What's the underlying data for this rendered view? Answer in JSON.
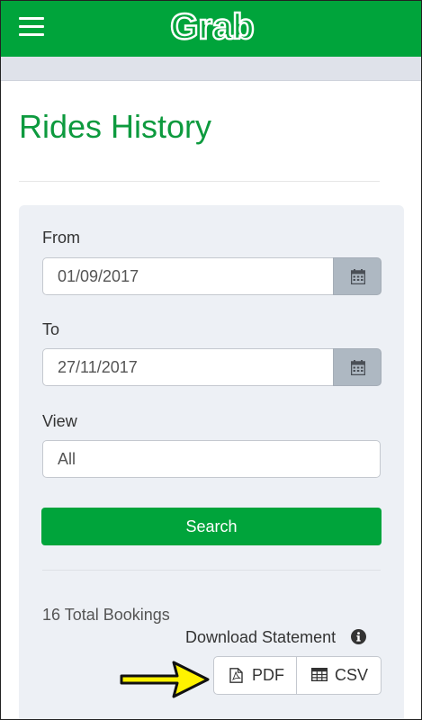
{
  "header": {
    "brand": "Grab",
    "menu_icon": "hamburger-icon",
    "color": "#00a43b"
  },
  "page": {
    "title": "Rides History",
    "title_color": "#0d9a3e"
  },
  "filters": {
    "from_label": "From",
    "from_value": "01/09/2017",
    "to_label": "To",
    "to_value": "27/11/2017",
    "calendar_icon": "calendar-icon",
    "view_label": "View",
    "view_value": "All",
    "search_label": "Search"
  },
  "results": {
    "total_bookings": "16 Total Bookings",
    "download_label": "Download Statement",
    "info_icon": "info-icon",
    "pdf_label": "PDF",
    "pdf_icon": "pdf-file-icon",
    "csv_label": "CSV",
    "csv_icon": "table-icon"
  },
  "annotation": {
    "arrow_icon": "arrow-right-icon",
    "arrow_color": "#fff200"
  }
}
